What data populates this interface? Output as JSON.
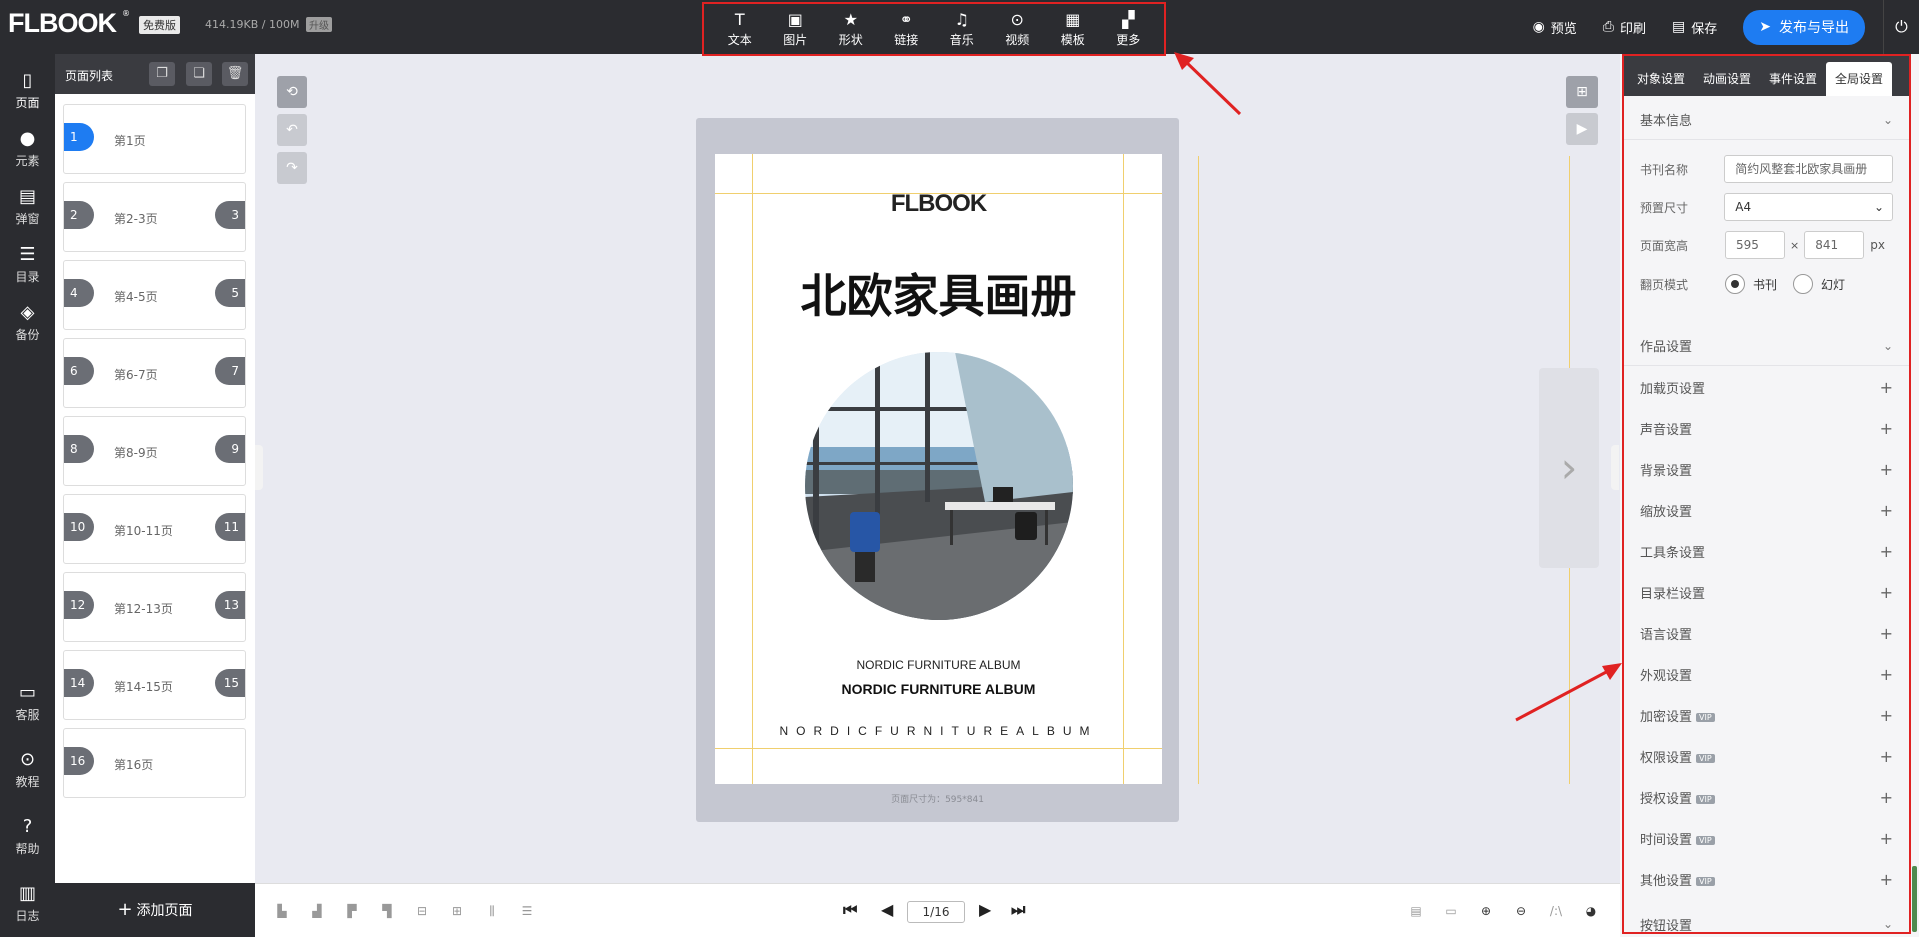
{
  "header": {
    "logo": "FLBOOK",
    "plan_badge": "免费版",
    "usage": "414.19KB / 100M",
    "upgrade": "升级",
    "tools": [
      {
        "label": "文本",
        "icon": "text-icon"
      },
      {
        "label": "图片",
        "icon": "image-icon"
      },
      {
        "label": "形状",
        "icon": "star-icon"
      },
      {
        "label": "链接",
        "icon": "link-icon"
      },
      {
        "label": "音乐",
        "icon": "music-icon"
      },
      {
        "label": "视频",
        "icon": "video-icon"
      },
      {
        "label": "模板",
        "icon": "template-icon"
      },
      {
        "label": "更多",
        "icon": "more-icon"
      }
    ],
    "preview": "预览",
    "print": "印刷",
    "save": "保存",
    "publish": "发布与导出"
  },
  "leftbar": {
    "items": [
      "页面",
      "元素",
      "弹窗",
      "目录",
      "备份"
    ],
    "bottom_items": [
      "客服",
      "教程",
      "帮助",
      "日志"
    ]
  },
  "pages_panel": {
    "title": "页面列表",
    "pages": [
      {
        "label": "第1页",
        "left": "1",
        "right": ""
      },
      {
        "label": "第2-3页",
        "left": "2",
        "right": "3"
      },
      {
        "label": "第4-5页",
        "left": "4",
        "right": "5"
      },
      {
        "label": "第6-7页",
        "left": "6",
        "right": "7"
      },
      {
        "label": "第8-9页",
        "left": "8",
        "right": "9"
      },
      {
        "label": "第10-11页",
        "left": "10",
        "right": "11"
      },
      {
        "label": "第12-13页",
        "left": "12",
        "right": "13"
      },
      {
        "label": "第14-15页",
        "left": "14",
        "right": "15"
      },
      {
        "label": "第16页",
        "left": "16",
        "right": ""
      }
    ],
    "add_page": "添加页面"
  },
  "canvas": {
    "page_logo": "FLBOOK",
    "title": "北欧家具画册",
    "subtitle1": "NORDIC FURNITURE ALBUM",
    "subtitle2": "NORDIC FURNITURE ALBUM",
    "subtitle3": "NORDICFURNITUREALBUM",
    "page_size": "页面尺寸为：595*841"
  },
  "bottombar": {
    "pager": "1/16"
  },
  "right_panel": {
    "tabs": [
      "对象设置",
      "动画设置",
      "事件设置",
      "全局设置"
    ],
    "basic_info": "基本信息",
    "fields": {
      "book_name_label": "书刊名称",
      "book_name_value": "简约风整套北欧家具画册",
      "preset_label": "预置尺寸",
      "preset_value": "A4",
      "size_label": "页面宽高",
      "width": "595",
      "height": "841",
      "times": "×",
      "unit": "px",
      "flip_label": "翻页模式",
      "flip_book": "书刊",
      "flip_slide": "幻灯"
    },
    "work_settings": "作品设置",
    "settings": [
      {
        "label": "加载页设置",
        "vip": ""
      },
      {
        "label": "声音设置",
        "vip": ""
      },
      {
        "label": "背景设置",
        "vip": ""
      },
      {
        "label": "缩放设置",
        "vip": ""
      },
      {
        "label": "工具条设置",
        "vip": ""
      },
      {
        "label": "目录栏设置",
        "vip": ""
      },
      {
        "label": "语言设置",
        "vip": ""
      },
      {
        "label": "外观设置",
        "vip": ""
      },
      {
        "label": "加密设置",
        "vip": "VIP"
      },
      {
        "label": "权限设置",
        "vip": "VIP"
      },
      {
        "label": "授权设置",
        "vip": "VIP"
      },
      {
        "label": "时间设置",
        "vip": "VIP"
      },
      {
        "label": "其他设置",
        "vip": "VIP"
      }
    ],
    "cut_section": "按钮设置"
  },
  "colors": {
    "accent": "#1e7cf2",
    "annotation": "#e02222",
    "dark": "#2b2c30"
  }
}
